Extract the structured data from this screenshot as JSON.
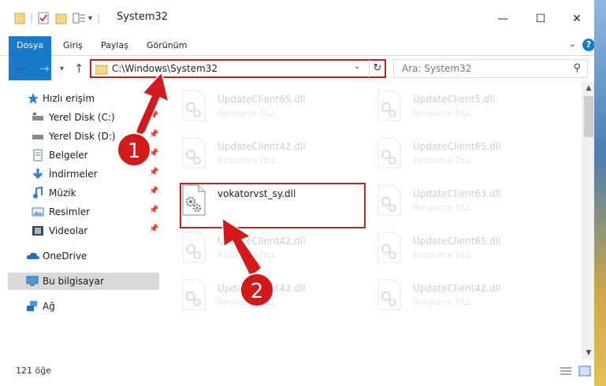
{
  "window": {
    "title": "System32",
    "minimize_glyph": "—",
    "maximize_glyph": "☐",
    "close_glyph": "✕"
  },
  "ribbon": {
    "tabs": [
      {
        "label": "Dosya",
        "active": true
      },
      {
        "label": "Giriş"
      },
      {
        "label": "Paylaş"
      },
      {
        "label": "Görünüm"
      }
    ],
    "help_label": "?"
  },
  "navigation": {
    "back_glyph": "←",
    "forward_glyph": "→",
    "recent_glyph": "▾",
    "up_glyph": "↑",
    "address": "C:\\Windows\\System32",
    "refresh_glyph": "↻",
    "search_placeholder": "Ara: System32"
  },
  "sidebar": {
    "items": [
      {
        "label": "Hızlı erişim",
        "icon": "star-icon",
        "pinned": false
      },
      {
        "label": "Yerel Disk (C:)",
        "icon": "drive-icon",
        "pinned": true
      },
      {
        "label": "Yerel Disk (D:)",
        "icon": "drive-icon",
        "pinned": true
      },
      {
        "label": "Belgeler",
        "icon": "documents-icon",
        "pinned": true
      },
      {
        "label": "İndirmeler",
        "icon": "download-icon",
        "pinned": true
      },
      {
        "label": "Müzik",
        "icon": "music-icon",
        "pinned": true
      },
      {
        "label": "Resimler",
        "icon": "pictures-icon",
        "pinned": true
      },
      {
        "label": "Videolar",
        "icon": "video-icon",
        "pinned": true
      },
      {
        "label": "OneDrive",
        "icon": "cloud-icon",
        "pinned": false
      },
      {
        "label": "Bu bilgisayar",
        "icon": "computer-icon",
        "pinned": false,
        "selected": true
      },
      {
        "label": "Ağ",
        "icon": "network-icon",
        "pinned": false
      }
    ]
  },
  "files": {
    "left_column": [
      {
        "name": "UpdateClient65.dll",
        "type": "Resource DLL",
        "faded": true
      },
      {
        "name": "UpdateClient42.dll",
        "type": "Resource DLL",
        "faded": true
      },
      {
        "name": "vokatorvst_sy.dll",
        "type": "",
        "faded": false,
        "highlighted": true
      },
      {
        "name": "UpdateClient42.dll",
        "type": "Resource DLL",
        "faded": true
      },
      {
        "name": "UpdateClient42.dll",
        "type": "Resource DLL",
        "faded": true
      }
    ],
    "right_column": [
      {
        "name": "UpdateClient5.dll",
        "type": "Resource DLL",
        "faded": true
      },
      {
        "name": "UpdateClient65.dll",
        "type": "Resource DLL",
        "faded": true
      },
      {
        "name": "UpdateClient63.dll",
        "type": "Resource DLL",
        "faded": true
      },
      {
        "name": "UpdateClient65.dll",
        "type": "Resource DLL",
        "faded": true
      },
      {
        "name": "UpdateClient42.dll",
        "type": "Resource DLL",
        "faded": true
      }
    ]
  },
  "status": {
    "item_count": "121 öğe"
  },
  "annotations": {
    "step1": "1",
    "step2": "2",
    "color": "#d21a1a"
  },
  "colors": {
    "accent": "#1979ca",
    "highlight_red": "#d21a1a",
    "selected_bg": "#d9d9d9"
  }
}
